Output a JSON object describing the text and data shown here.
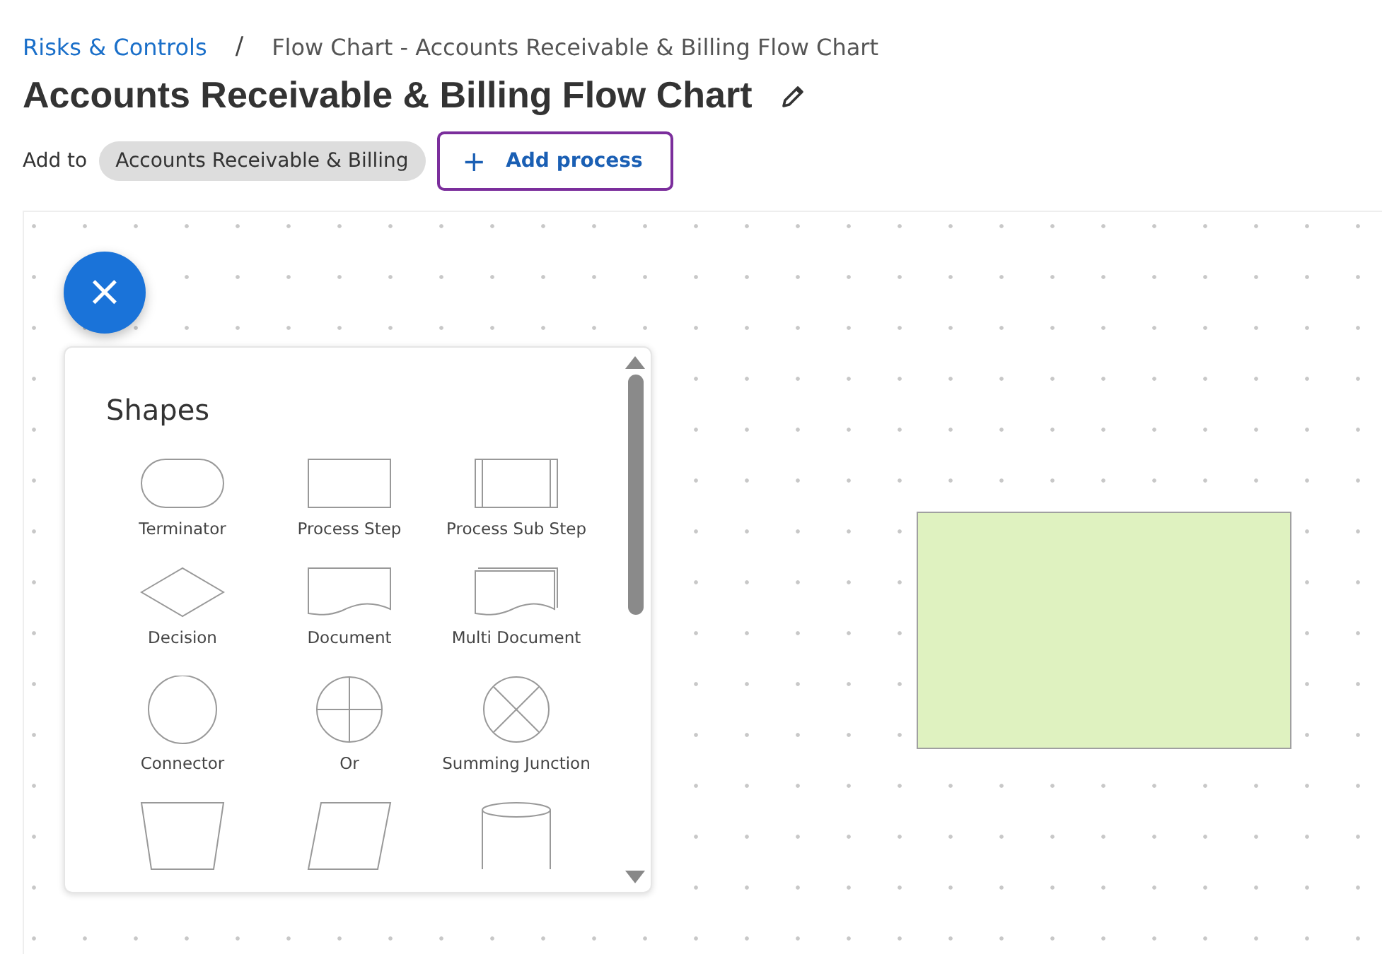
{
  "breadcrumbs": [
    {
      "label": "Risks & Controls",
      "kind": "link"
    },
    {
      "label": "Flow Chart - Accounts Receivable & Billing Flow Chart",
      "kind": "current"
    }
  ],
  "breadcrumb_separator": "/",
  "title": "Accounts Receivable & Billing Flow Chart",
  "add_to": {
    "label": "Add to",
    "chip": "Accounts Receivable & Billing",
    "button": "Add process",
    "button_icon": "+"
  },
  "fab": {
    "symbol": "×"
  },
  "shapes_panel": {
    "title": "Shapes",
    "shapes": [
      {
        "kind": "terminator",
        "label": "Terminator"
      },
      {
        "kind": "process",
        "label": "Process Step"
      },
      {
        "kind": "subprocess",
        "label": "Process Sub Step"
      },
      {
        "kind": "decision",
        "label": "Decision"
      },
      {
        "kind": "document",
        "label": "Document"
      },
      {
        "kind": "multidocument",
        "label": "Multi Document"
      },
      {
        "kind": "connector",
        "label": "Connector"
      },
      {
        "kind": "or",
        "label": "Or"
      },
      {
        "kind": "summing",
        "label": "Summing Junction"
      },
      {
        "kind": "manual"
      },
      {
        "kind": "data"
      },
      {
        "kind": "database"
      }
    ]
  },
  "canvas_nodes": [
    {
      "kind": "process",
      "color": "#dff2c0"
    }
  ]
}
